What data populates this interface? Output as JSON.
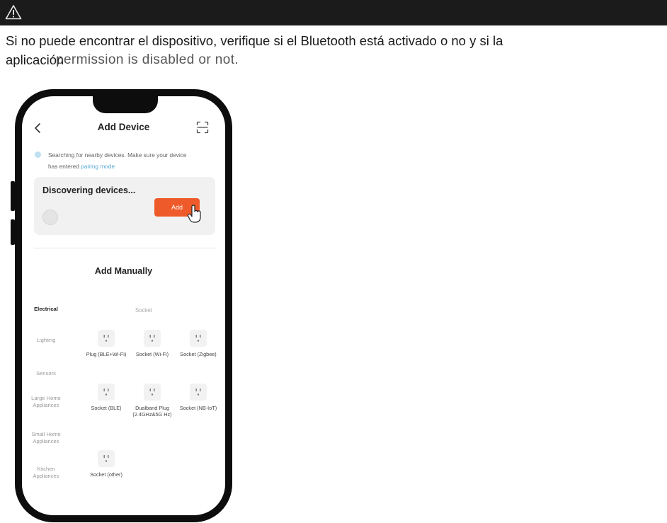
{
  "warning_icon": "warning-triangle-icon",
  "note": {
    "line1": "Si no puede encontrar el dispositivo, verifique si el Bluetooth está activado o no y si la",
    "line2_a": "aplicación",
    "line2_b": "permission is disabled or not."
  },
  "app": {
    "title": "Add Device",
    "back_icon": "chevron-left-icon",
    "scan_icon": "scan-icon",
    "hint_line1": "Searching for nearby devices. Make sure your device",
    "hint_line2_prefix": "has entered",
    "hint_link": "pairing mode",
    "discover_title": "Discovering devices...",
    "add_button": "Add",
    "add_button_color": "#ee5a2a",
    "manual_title": "Add Manually",
    "categories": [
      {
        "label": "Electrical",
        "active": true
      },
      {
        "label": "Lighting",
        "active": false
      },
      {
        "label": "Sensors",
        "active": false
      },
      {
        "label": "Large Home Appliances",
        "active": false
      },
      {
        "label": "Small Home Appliances",
        "active": false
      },
      {
        "label": "Kitchen Appliances",
        "active": false
      }
    ],
    "socket_header": "Socket",
    "devices": [
      {
        "label": "Plug (BLE+Wi-Fi)",
        "icon": "socket-icon"
      },
      {
        "label": "Socket (Wi-Fi)",
        "icon": "socket-icon"
      },
      {
        "label": "Socket (Zigbee)",
        "icon": "socket-icon"
      },
      {
        "label": "Socket (BLE)",
        "icon": "socket-icon"
      },
      {
        "label": "Dualband Plug (2.4GHz&5G Hz)",
        "icon": "socket-icon"
      },
      {
        "label": "Socket (NB-IoT)",
        "icon": "socket-icon"
      },
      {
        "label": "Socket (other)",
        "icon": "socket-icon"
      }
    ]
  }
}
